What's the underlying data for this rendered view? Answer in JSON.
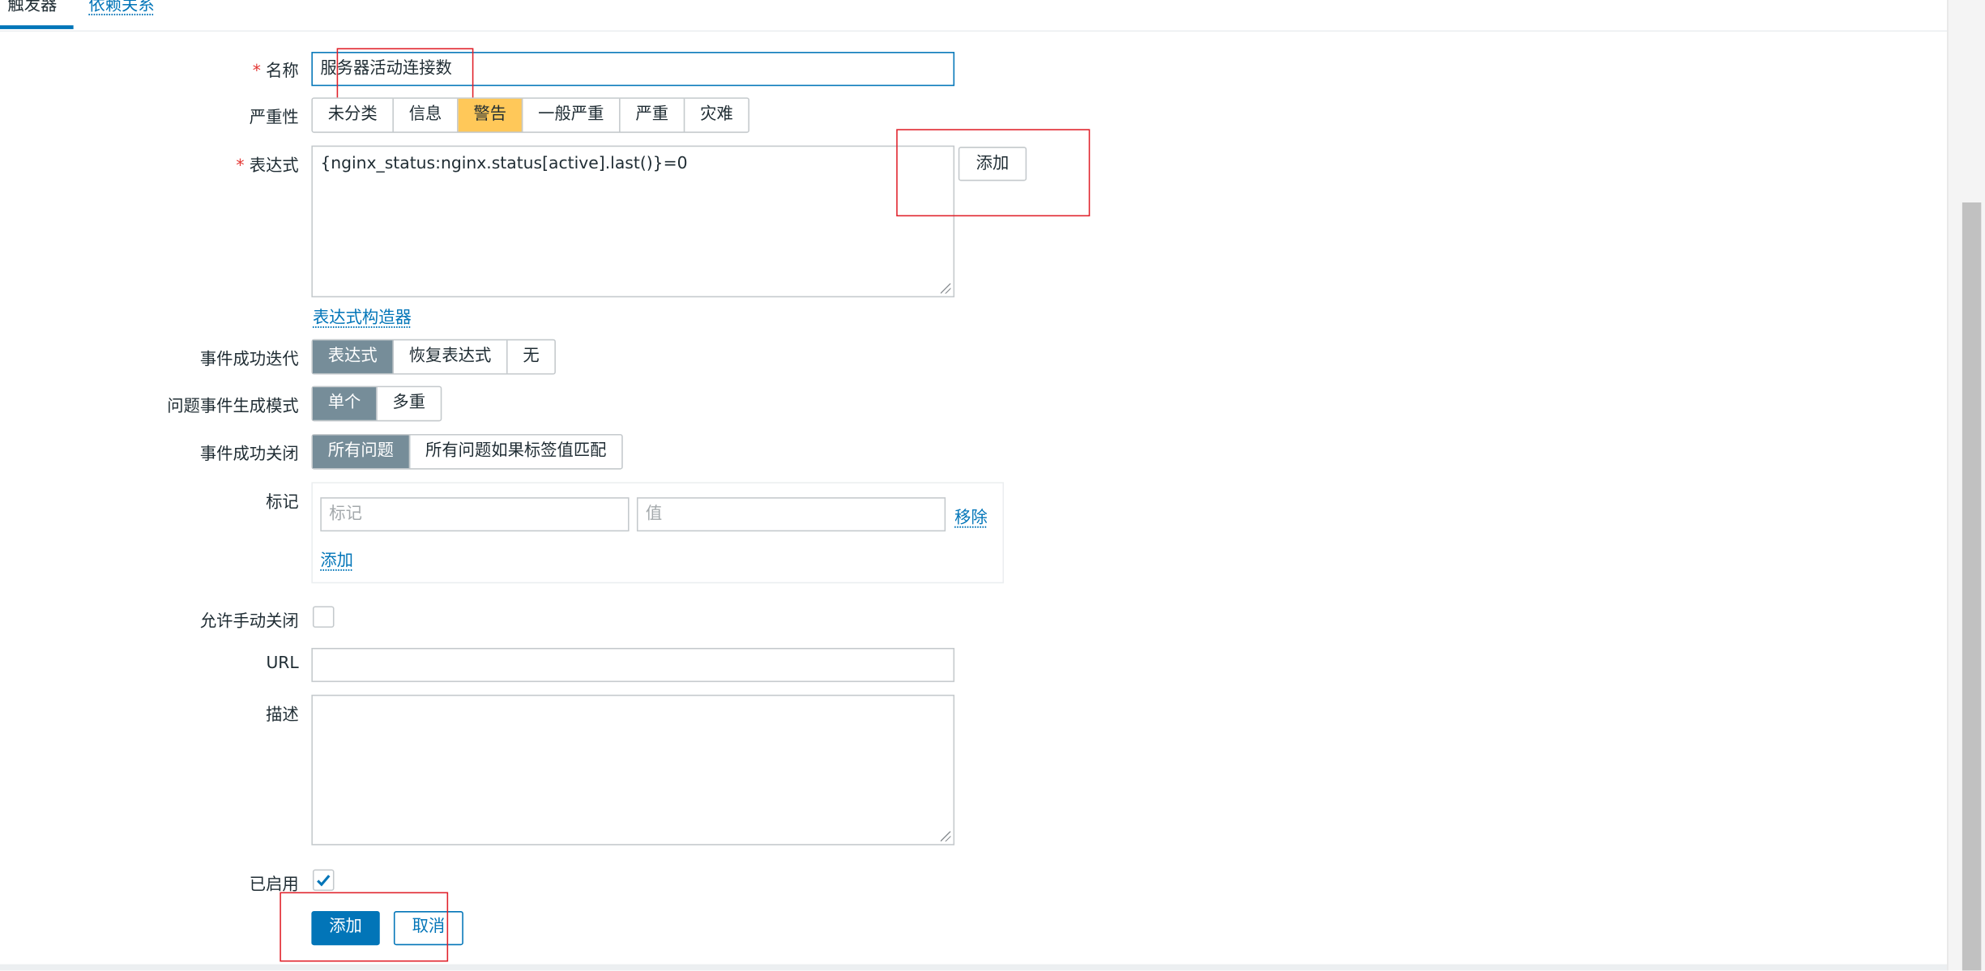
{
  "tabs": [
    {
      "label": "触发器",
      "active": true
    },
    {
      "label": "依赖关系",
      "active": false
    }
  ],
  "form": {
    "name": {
      "label": "名称",
      "value": "服务器活动连接数"
    },
    "severity": {
      "label": "严重性",
      "options": [
        "未分类",
        "信息",
        "警告",
        "一般严重",
        "严重",
        "灾难"
      ],
      "selected": "警告"
    },
    "expression": {
      "label": "表达式",
      "value": "{nginx_status:nginx.status[active].last()}=0",
      "add_button": "添加",
      "constructor_link": "表达式构造器"
    },
    "ok_event_generation": {
      "label": "事件成功迭代",
      "options": [
        "表达式",
        "恢复表达式",
        "无"
      ],
      "selected": "表达式"
    },
    "problem_event_mode": {
      "label": "问题事件生成模式",
      "options": [
        "单个",
        "多重"
      ],
      "selected": "单个"
    },
    "ok_event_closes": {
      "label": "事件成功关闭",
      "options": [
        "所有问题",
        "所有问题如果标签值匹配"
      ],
      "selected": "所有问题"
    },
    "tags": {
      "label": "标记",
      "tag_placeholder": "标记",
      "value_placeholder": "值",
      "remove_link": "移除",
      "add_link": "添加"
    },
    "allow_manual_close": {
      "label": "允许手动关闭",
      "checked": false
    },
    "url": {
      "label": "URL",
      "value": ""
    },
    "description": {
      "label": "描述",
      "value": ""
    },
    "enabled": {
      "label": "已启用",
      "checked": true
    },
    "submit_label": "添加",
    "cancel_label": "取消"
  },
  "colors": {
    "accent": "#0275b8",
    "selected_gray": "#768d99",
    "warning_yellow": "#ffc859",
    "annotation_red": "#e0202a",
    "required_star": "#e33734"
  },
  "icons": {
    "required": "asterisk",
    "enabled_check": "checkmark-icon",
    "textarea_resize": "resize-grip-icon"
  }
}
